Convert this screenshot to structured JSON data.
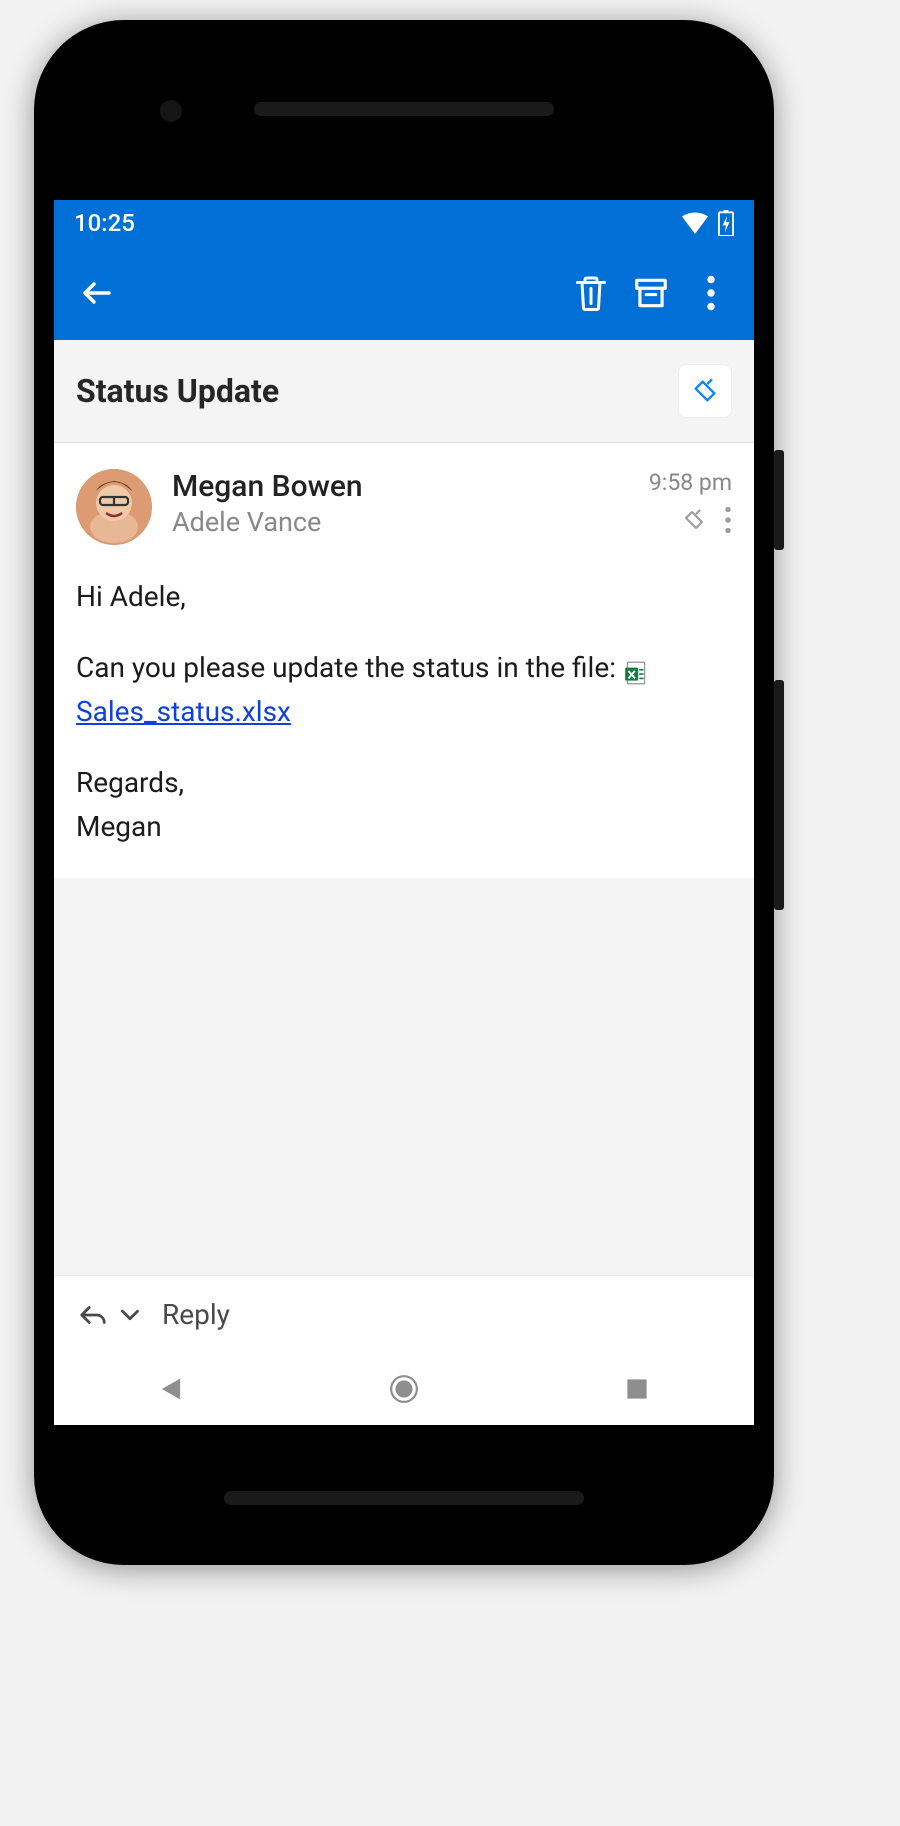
{
  "statusbar": {
    "time": "10:25"
  },
  "appbar": {
    "back": "back-icon",
    "delete": "trash-icon",
    "archive": "archive-icon",
    "overflow": "more-icon"
  },
  "subject": {
    "text": "Status Update",
    "label_icon": "tag-icon"
  },
  "message": {
    "sender_name": "Megan Bowen",
    "recipient_name": "Adele Vance",
    "time": "9:58 pm",
    "tag_icon": "tag-icon",
    "more_icon": "more-icon",
    "body": {
      "greeting": "Hi Adele,",
      "line1_pre": "Can you please update the status in the file: ",
      "attachment_name": "Sales_status.xlsx",
      "sign1": "Regards,",
      "sign2": "Megan"
    }
  },
  "reply": {
    "label": "Reply"
  },
  "nav": {
    "back": "nav-back",
    "home": "nav-home",
    "recent": "nav-recent"
  }
}
